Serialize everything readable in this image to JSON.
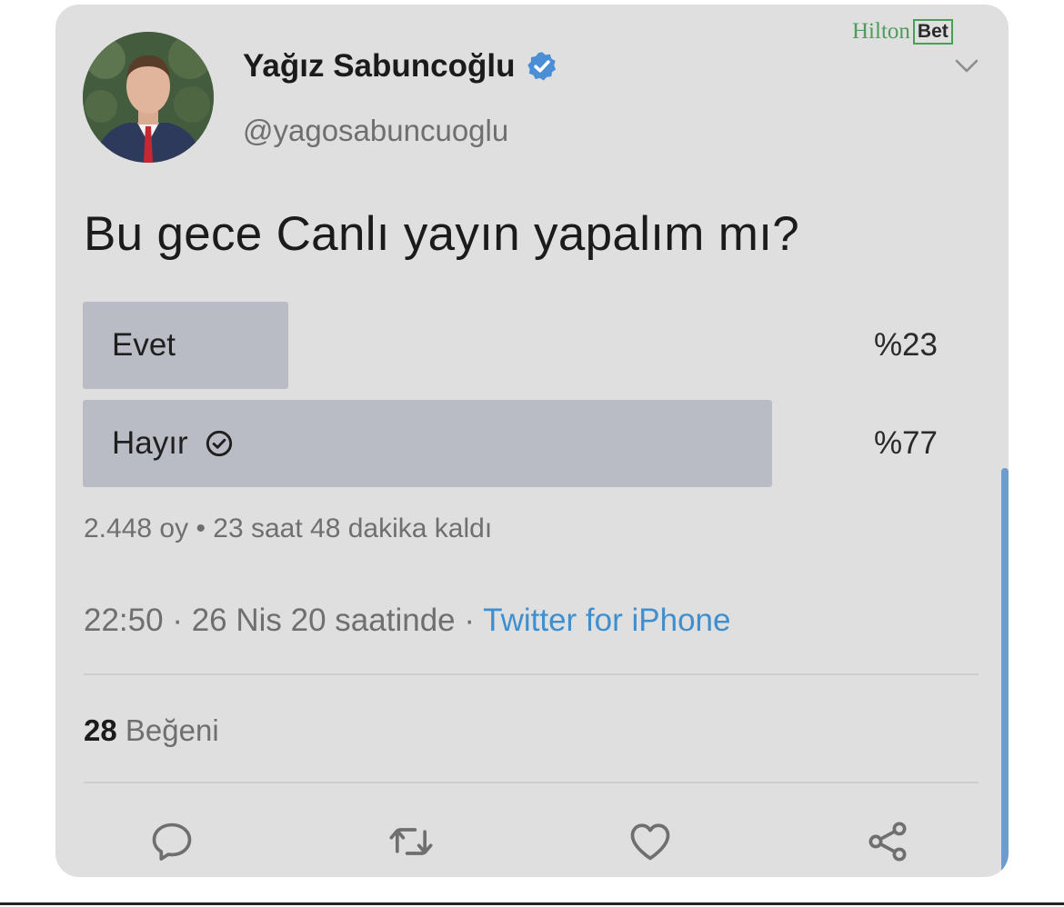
{
  "watermark": {
    "brand": "Hilton",
    "badge": "Bet"
  },
  "author": {
    "name": "Yağız Sabuncoğlu",
    "handle": "@yagosabuncuoglu",
    "verified": true
  },
  "tweet": {
    "text": "Bu gece Canlı yayın yapalım mı?"
  },
  "poll": {
    "options": [
      {
        "label": "Evet",
        "percent_label": "%23",
        "share": 0.23,
        "selected": false
      },
      {
        "label": "Hayır",
        "percent_label": "%77",
        "share": 0.77,
        "selected": true
      }
    ],
    "votes": "2.448 oy",
    "separator": "•",
    "time_left": "23 saat 48 dakika kaldı"
  },
  "meta": {
    "time": "22:50",
    "date": "26 Nis 20 saatinde",
    "separator": "·",
    "source": "Twitter for iPhone"
  },
  "stats": {
    "likes_count": "28",
    "likes_label": "Beğeni"
  },
  "actions": {
    "reply_icon": "reply-icon",
    "retweet_icon": "retweet-icon",
    "like_icon": "heart-icon",
    "share_icon": "share-icon"
  },
  "colors": {
    "card_bg": "#dfdfdf",
    "poll_fill": "#b9bcc4",
    "link": "#3f8fcf",
    "verified": "#4a8fd6",
    "watermark_green": "#4d9c5a"
  }
}
